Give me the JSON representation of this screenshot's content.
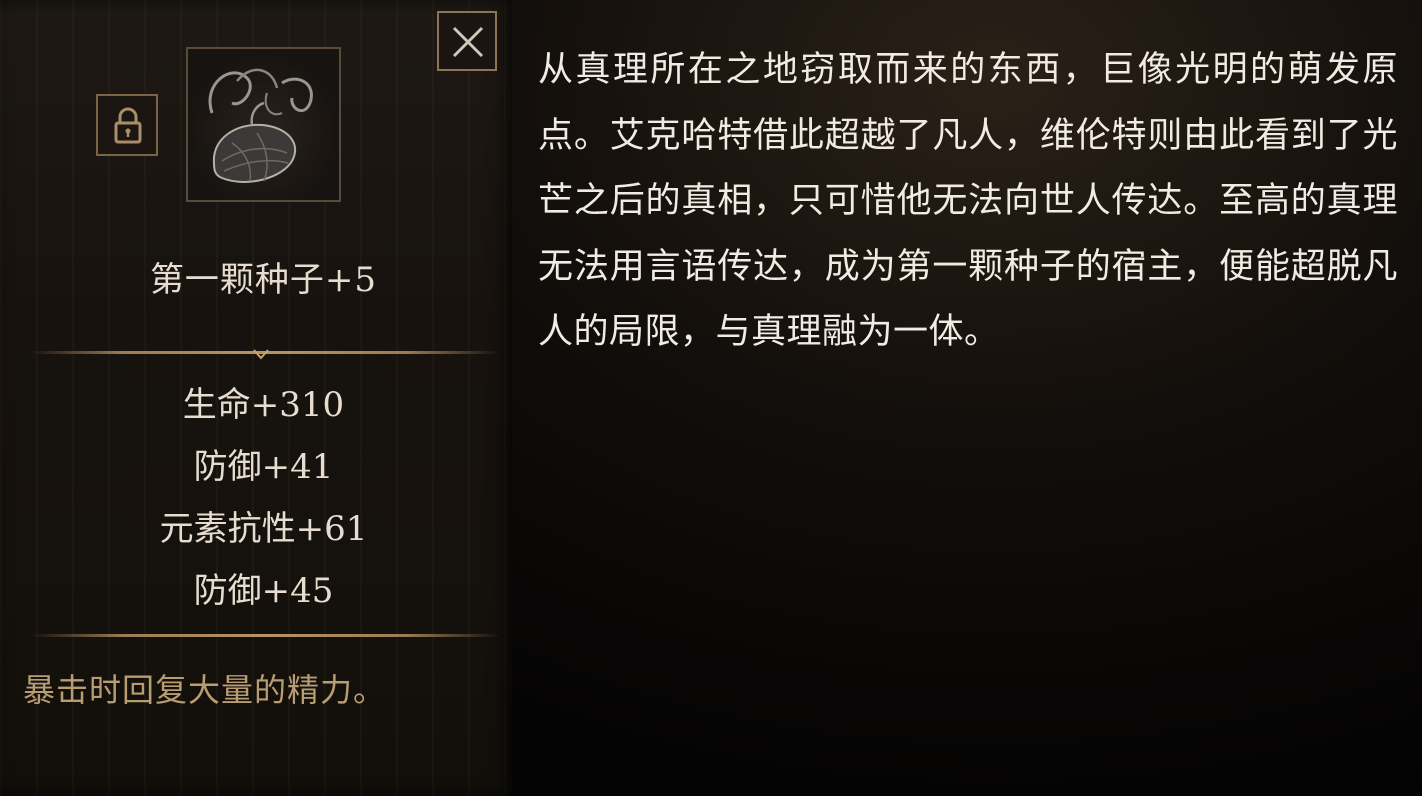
{
  "item": {
    "name": "第一颗种子+5",
    "icon": "seed-creature-icon",
    "locked": true
  },
  "stats": [
    "生命+310",
    "防御+41",
    "元素抗性+61",
    "防御+45"
  ],
  "effect": "暴击时回复大量的精力。",
  "description": "从真理所在之地窃取而来的东西，巨像光明的萌发原点。艾克哈特借此超越了凡人，维伦特则由此看到了光芒之后的真相，只可惜他无法向世人传达。至高的真理无法用言语传达，成为第一颗种子的宿主，便能超脱凡人的局限，与真理融为一体。",
  "controls": {
    "close_icon": "close-icon",
    "lock_icon": "lock-icon"
  },
  "colors": {
    "panel_border": "#8e7452",
    "stat_text": "#e6ddd0",
    "effect_text": "#b89c72",
    "description_text": "#f0ebe3"
  }
}
